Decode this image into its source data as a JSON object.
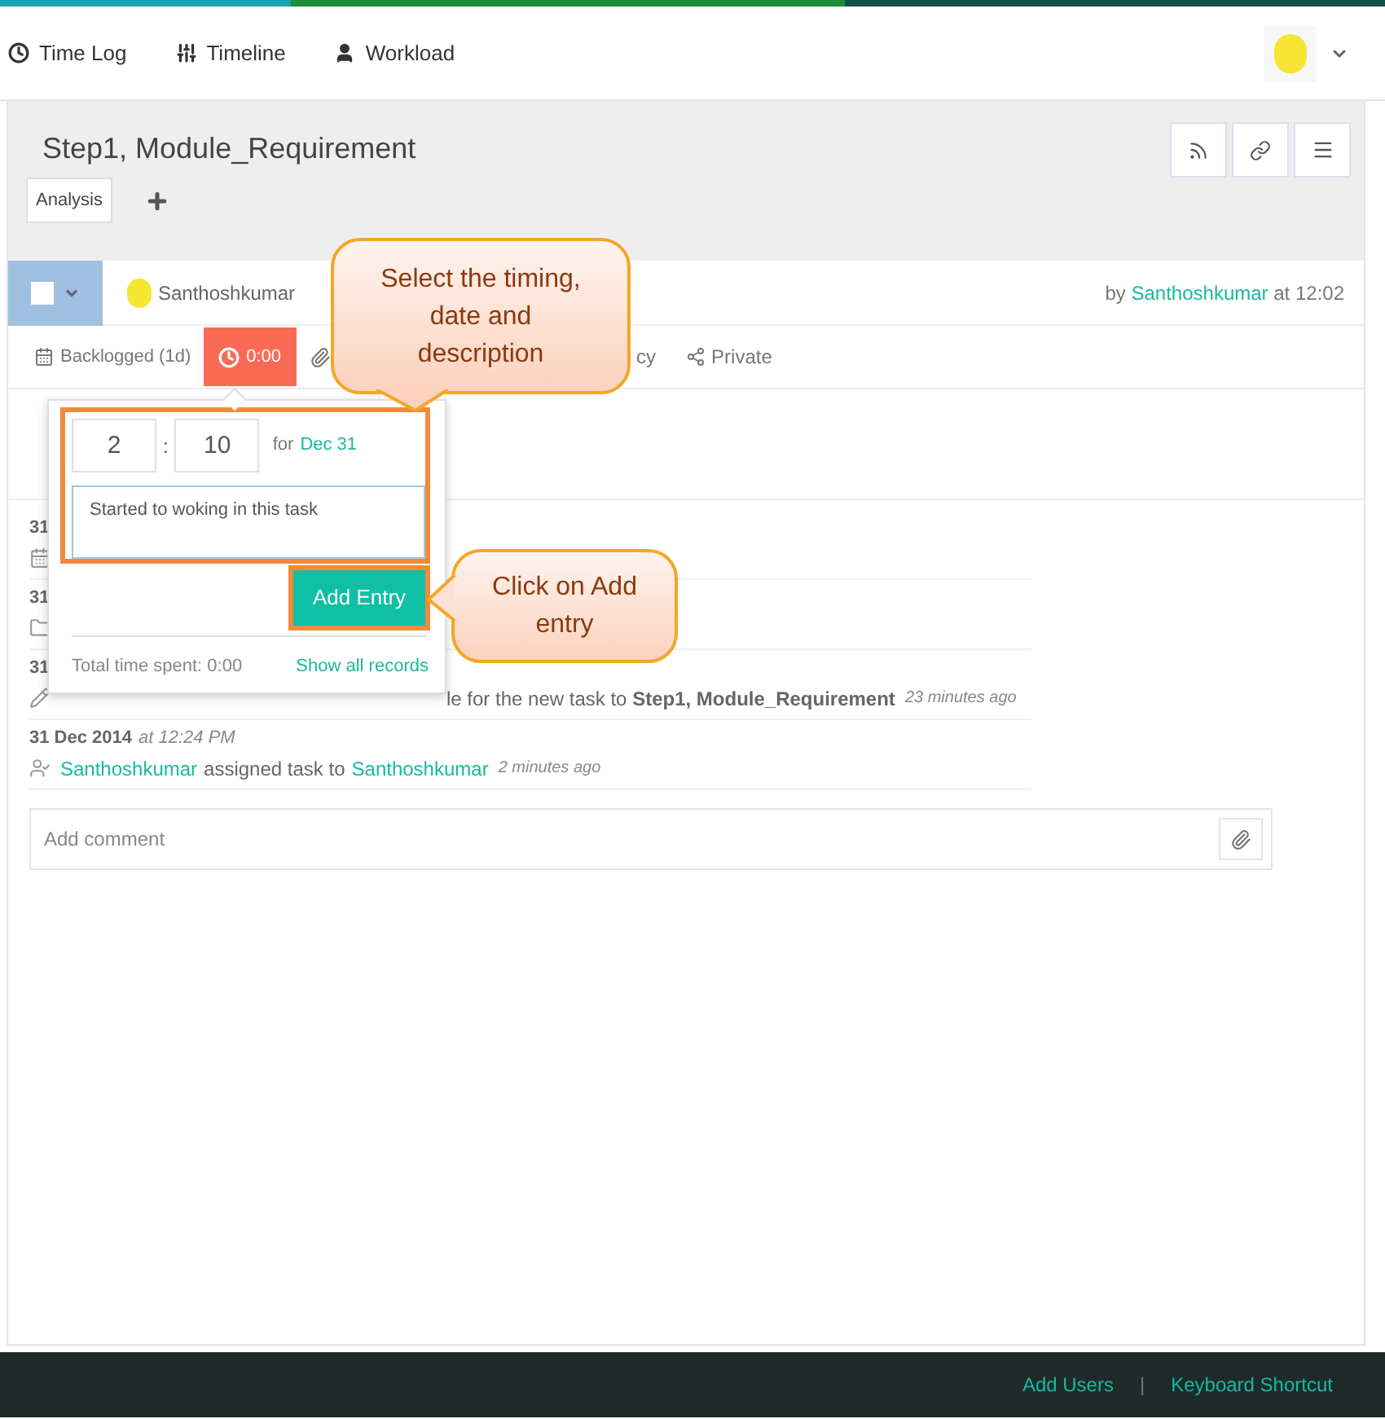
{
  "nav": [
    {
      "label": "Time Log",
      "kind": "clock"
    },
    {
      "label": "Timeline",
      "kind": "sliders"
    },
    {
      "label": "Workload",
      "kind": "user"
    }
  ],
  "task": {
    "title": "Step1, Module_Requirement",
    "tags": [
      "Analysis"
    ]
  },
  "header_row": {
    "author": "Santhoshkumar",
    "by_prefix": "by",
    "by_name": "Santhoshkumar",
    "by_suffix": "at 12:02"
  },
  "tabs": [
    {
      "kind": "status",
      "label": "Backlogged (1d)",
      "selected": false
    },
    {
      "kind": "timer",
      "label": "0:00",
      "selected": true
    },
    {
      "kind": "attachment",
      "selected": false
    },
    {
      "kind": "plain",
      "label": "cy",
      "selected": false
    },
    {
      "kind": "share",
      "label": "Private",
      "selected": false
    }
  ],
  "select_all": {
    "checked": false
  },
  "activity": [
    {
      "kind": "calendar",
      "date": "31"
    },
    {
      "kind": "folder",
      "date": "31"
    },
    {
      "kind": "edit",
      "date": "31",
      "text": "le for the new task to **Step1, Module_Requirement**",
      "ago": "23 minutes ago"
    },
    {
      "kind": "assign",
      "date": "31 Dec 2014",
      "time": "at 12:24 PM",
      "actor": "Santhoshkumar",
      "text": "assigned task to",
      "target": "Santhoshkumar",
      "ago": "2 minutes ago"
    }
  ],
  "time_popover": {
    "hours": "2",
    "separator": ":",
    "minutes": "10",
    "for_label": "for",
    "date": "Dec 31",
    "description": "Started to woking in this task",
    "button": "Add Entry",
    "total": "Total time spent: 0:00",
    "link": "Show all records"
  },
  "comment": {
    "placeholder": "Add comment"
  },
  "callouts": [
    {
      "kind": "down",
      "text": "Select the timing, date and description"
    },
    {
      "kind": "left",
      "text": "Click on Add entry"
    }
  ],
  "footer": {
    "links": [
      "Add Users",
      "Keyboard Shortcut"
    ],
    "separator": "|"
  }
}
